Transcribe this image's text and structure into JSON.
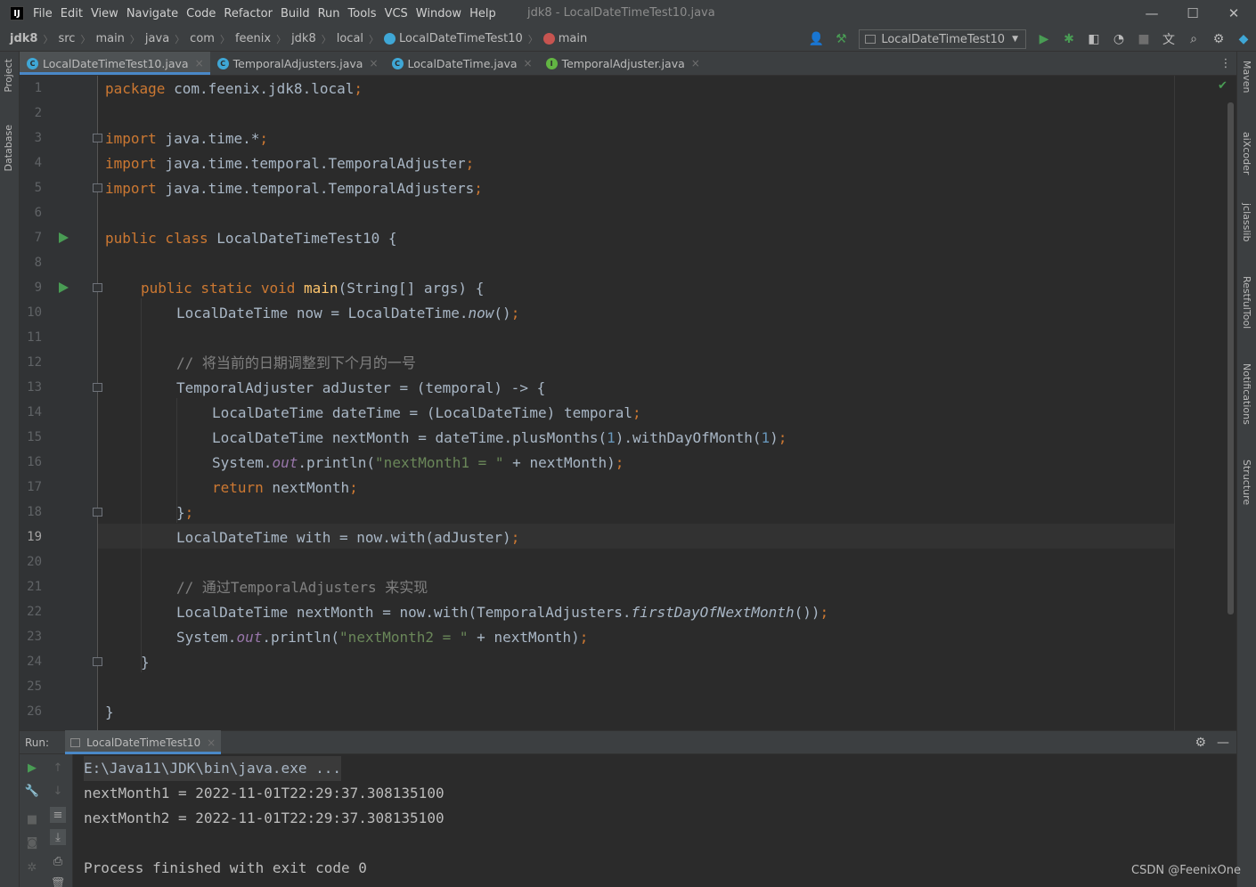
{
  "menu": {
    "items": [
      "File",
      "Edit",
      "View",
      "Navigate",
      "Code",
      "Refactor",
      "Build",
      "Run",
      "Tools",
      "VCS",
      "Window",
      "Help"
    ],
    "window_title": "jdk8 - LocalDateTimeTest10.java"
  },
  "breadcrumb": {
    "items": [
      "jdk8",
      "src",
      "main",
      "java",
      "com",
      "feenix",
      "jdk8",
      "local",
      "LocalDateTimeTest10",
      "main"
    ]
  },
  "toolbar": {
    "run_config": "LocalDateTimeTest10"
  },
  "left_tools": [
    "Project",
    "Database"
  ],
  "right_tools": [
    "Maven",
    "aiXcoder",
    "jclasslib",
    "RestfulTool",
    "Notifications",
    "Structure"
  ],
  "tabs": [
    {
      "label": "LocalDateTimeTest10.java",
      "icon_color": "#3fa7d6"
    },
    {
      "label": "TemporalAdjusters.java",
      "icon_color": "#3fa7d6"
    },
    {
      "label": "LocalDateTime.java",
      "icon_color": "#3fa7d6"
    },
    {
      "label": "TemporalAdjuster.java",
      "icon_color": "#62b543"
    }
  ],
  "editor": {
    "line_numbers": [
      "1",
      "2",
      "3",
      "4",
      "5",
      "6",
      "7",
      "8",
      "9",
      "10",
      "11",
      "12",
      "13",
      "14",
      "15",
      "16",
      "17",
      "18",
      "19",
      "20",
      "21",
      "22",
      "23",
      "24",
      "25",
      "26"
    ],
    "current_line": "19"
  },
  "code": {
    "l1": {
      "kw": "package",
      "rest": " com.feenix.jdk8.local",
      "semi": ";"
    },
    "l3": {
      "kw": "import",
      "rest": " java.time.*",
      "semi": ";"
    },
    "l4": {
      "kw": "import",
      "rest": " java.time.temporal.TemporalAdjuster",
      "semi": ";"
    },
    "l5": {
      "kw": "import",
      "rest": " java.time.temporal.TemporalAdjusters",
      "semi": ";"
    },
    "l7": {
      "kw": "public class",
      "rest": " LocalDateTimeTest10 {"
    },
    "l9": {
      "kw": "public static void",
      "fn": "main",
      "rest": "(String[] args) {"
    },
    "l10": {
      "a": "LocalDateTime now = LocalDateTime.",
      "it": "now",
      "b": "()",
      "semi": ";"
    },
    "l12": {
      "cmt": "// 将当前的日期调整到下个月的一号"
    },
    "l13": {
      "a": "TemporalAdjuster adJuster = (temporal) -> {"
    },
    "l14": {
      "a": "LocalDateTime dateTime = (LocalDateTime) temporal",
      "semi": ";"
    },
    "l15": {
      "a": "LocalDateTime nextMonth = dateTime.plusMonths(",
      "n1": "1",
      "b": ").withDayOfMonth(",
      "n2": "1",
      "c": ")",
      "semi": ";"
    },
    "l16": {
      "a": "System.",
      "fld": "out",
      "b": ".println(",
      "str": "\"nextMonth1 = \"",
      "c": " + nextMonth)",
      "semi": ";"
    },
    "l17": {
      "kw": "return",
      "rest": " nextMonth",
      "semi": ";"
    },
    "l18": {
      "a": "}",
      "semi": ";"
    },
    "l19": {
      "a": "LocalDateTime with = now.with(adJuster)",
      "semi": ";"
    },
    "l21": {
      "cmt": "// 通过TemporalAdjusters 来实现"
    },
    "l22": {
      "a": "LocalDateTime nextMonth = now.with(TemporalAdjusters.",
      "it": "firstDayOfNextMonth",
      "b": "())",
      "semi": ";"
    },
    "l23": {
      "a": "System.",
      "fld": "out",
      "b": ".println(",
      "str": "\"nextMonth2 = \"",
      "c": " + nextMonth)",
      "semi": ";"
    },
    "l24": {
      "a": "}"
    },
    "l26": {
      "a": "}"
    }
  },
  "run_panel": {
    "label": "Run:",
    "tab": "LocalDateTimeTest10",
    "console": [
      "E:\\Java11\\JDK\\bin\\java.exe ...",
      "nextMonth1 = 2022-11-01T22:29:37.308135100",
      "nextMonth2 = 2022-11-01T22:29:37.308135100",
      "",
      "Process finished with exit code 0"
    ]
  },
  "watermark": "CSDN @FeenixOne"
}
